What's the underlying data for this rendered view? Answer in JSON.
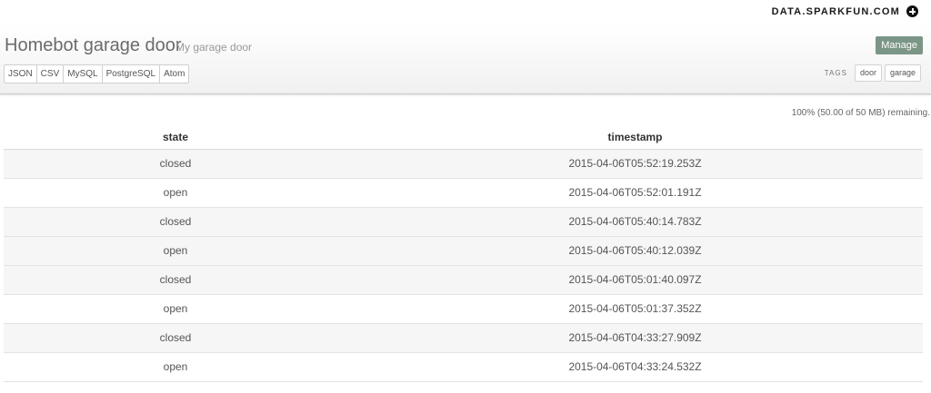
{
  "topbar": {
    "brand": "DATA.SPARKFUN.COM",
    "brand_icon": "plus-circle-icon"
  },
  "header": {
    "title": "Homebot garage door",
    "subtitle": "My garage door",
    "manage_label": "Manage",
    "formats": [
      "JSON",
      "CSV",
      "MySQL",
      "PostgreSQL",
      "Atom"
    ],
    "tags_label": "TAGS",
    "tags": [
      "door",
      "garage"
    ]
  },
  "storage": {
    "text": "100% (50.00 of 50 MB) remaining."
  },
  "table": {
    "columns": [
      "state",
      "timestamp"
    ],
    "rows": [
      {
        "state": "closed",
        "timestamp": "2015-04-06T05:52:19.253Z"
      },
      {
        "state": "open",
        "timestamp": "2015-04-06T05:52:01.191Z"
      },
      {
        "state": "closed",
        "timestamp": "2015-04-06T05:40:14.783Z"
      },
      {
        "state": "open",
        "timestamp": "2015-04-06T05:40:12.039Z"
      },
      {
        "state": "closed",
        "timestamp": "2015-04-06T05:01:40.097Z"
      },
      {
        "state": "open",
        "timestamp": "2015-04-06T05:01:37.352Z"
      },
      {
        "state": "closed",
        "timestamp": "2015-04-06T04:33:27.909Z"
      },
      {
        "state": "open",
        "timestamp": "2015-04-06T04:33:24.532Z"
      }
    ]
  }
}
